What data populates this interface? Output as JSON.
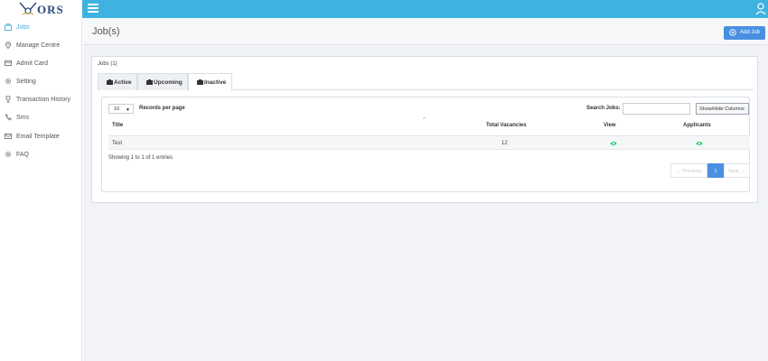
{
  "brand": {
    "name": "ORS"
  },
  "sidebar": {
    "items": [
      {
        "label": "Jobs",
        "icon": "briefcase-icon",
        "active": true
      },
      {
        "label": "Manage Centre",
        "icon": "map-pin-icon"
      },
      {
        "label": "Admit Card",
        "icon": "credit-card-icon"
      },
      {
        "label": "Setting",
        "icon": "gear-icon"
      },
      {
        "label": "Transaction History",
        "icon": "trophy-icon"
      },
      {
        "label": "Sms",
        "icon": "phone-icon"
      },
      {
        "label": "Email Template",
        "icon": "envelope-icon"
      },
      {
        "label": "FAQ",
        "icon": "gear-icon"
      }
    ]
  },
  "header": {
    "title": "Job(s)",
    "add_button": "Add Job"
  },
  "panel": {
    "title": "Jobs (1)",
    "tabs": [
      {
        "label": "Active",
        "active": false
      },
      {
        "label": "Upcoming",
        "active": false
      },
      {
        "label": "Inactive",
        "active": true
      }
    ]
  },
  "table_controls": {
    "records_value": "10",
    "records_label": "Records per page",
    "search_label": "Search Jobs:",
    "search_value": "",
    "columns_button": "Show/Hide Columns"
  },
  "table": {
    "columns": [
      "Title",
      "Total Vacancies",
      "View",
      "Applicants"
    ],
    "rows": [
      {
        "title": "Test",
        "vacancies": "12"
      }
    ]
  },
  "footer": {
    "info": "Showing 1 to 1 of 1 entries",
    "pagination": {
      "previous": "← Previous",
      "current": "1",
      "next": "Next →"
    }
  },
  "colors": {
    "topbar": "#3fb2e0",
    "accent": "#3fb2e0",
    "primary_button": "#4a90e2",
    "view_icon": "#2ecc71"
  }
}
